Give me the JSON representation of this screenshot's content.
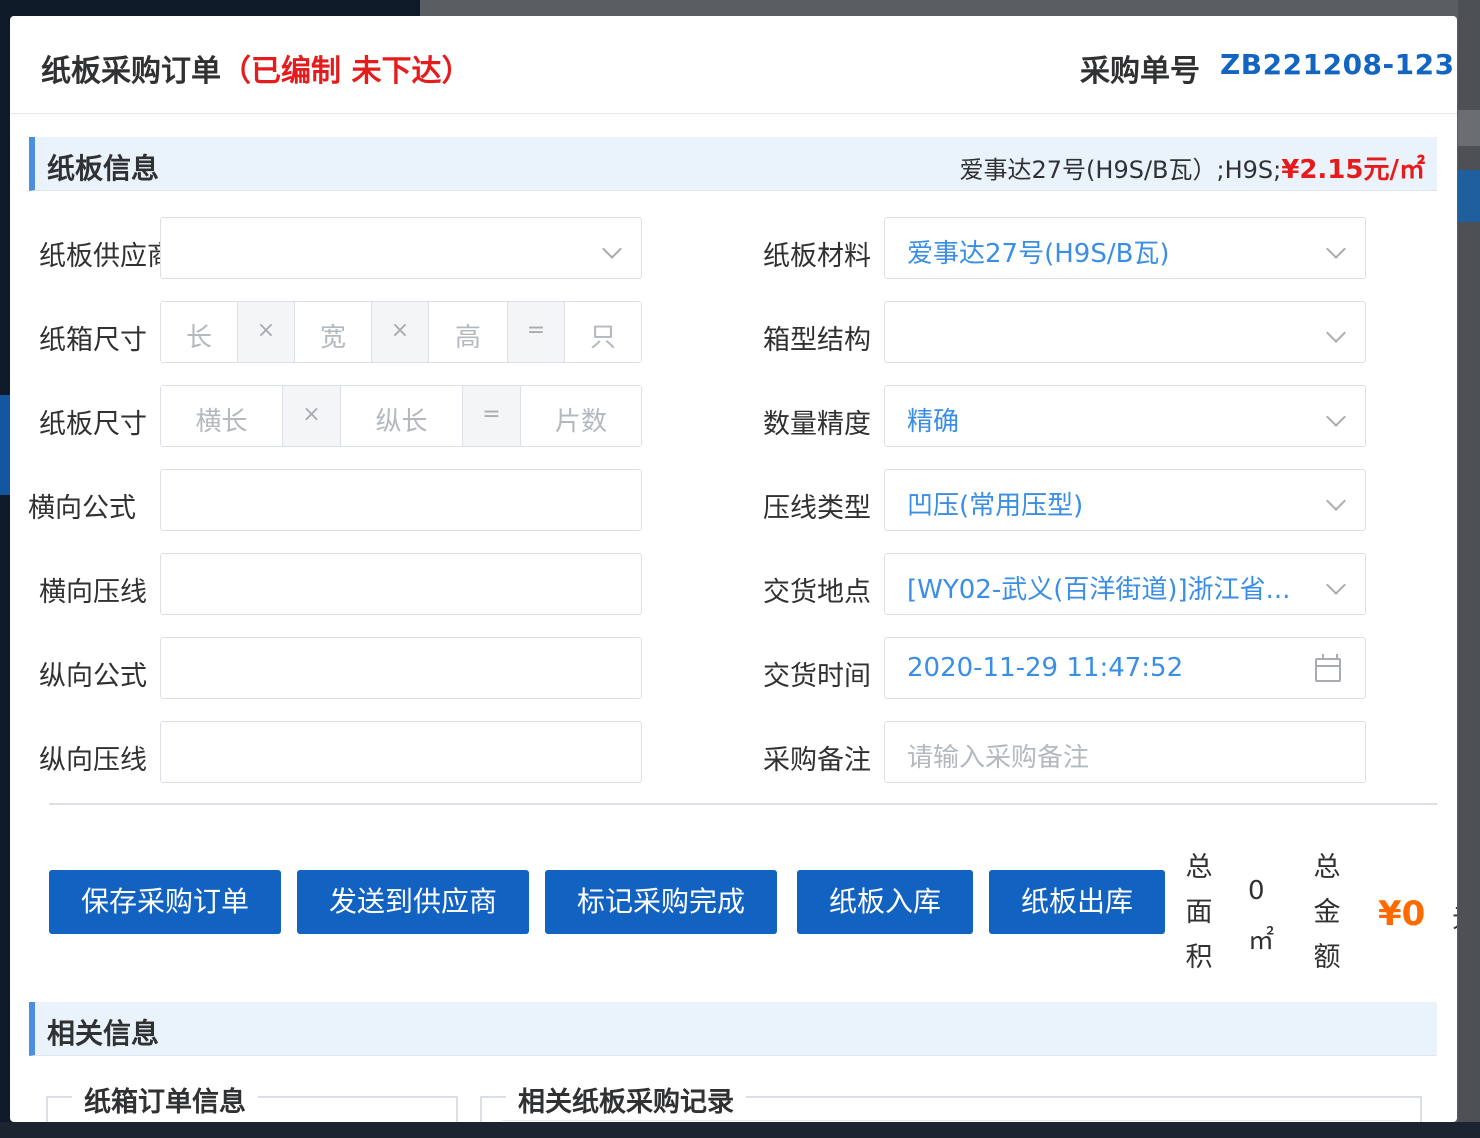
{
  "header": {
    "title": "纸板采购订单",
    "status": "（已编制 未下达）",
    "order_no_label": "采购单号",
    "order_no": "ZB221208-123"
  },
  "section_board": {
    "title": "纸板信息",
    "material_summary": "爱事达27号(H9S/B瓦）;H9S;",
    "price": "¥2.15元/㎡"
  },
  "left_form": {
    "supplier_label": "纸板供应商",
    "box_size_label": "纸箱尺寸",
    "box_size_ph": {
      "length": "长",
      "width": "宽",
      "height": "高",
      "count": "只"
    },
    "board_size_label": "纸板尺寸",
    "board_size_ph": {
      "h_len": "横长",
      "v_len": "纵长",
      "pieces": "片数"
    },
    "op_times": "×",
    "op_eq": "=",
    "h_formula_label": "横向公式",
    "h_crease_label": "横向压线",
    "v_formula_label": "纵向公式",
    "v_crease_label": "纵向压线"
  },
  "right_form": {
    "material_label": "纸板材料",
    "material_value": "爱事达27号(H9S/B瓦)",
    "structure_label": "箱型结构",
    "precision_label": "数量精度",
    "precision_value": "精确",
    "crease_type_label": "压线类型",
    "crease_type_value": "凹压(常用压型)",
    "delivery_place_label": "交货地点",
    "delivery_place_value": "[WY02-武义(百洋街道)]浙江省...",
    "delivery_time_label": "交货时间",
    "delivery_time_value": "2020-11-29 11:47:52",
    "remark_label": "采购备注",
    "remark_ph": "请输入采购备注"
  },
  "actions": {
    "save": "保存采购订单",
    "send": "发送到供应商",
    "mark_done": "标记采购完成",
    "stock_in": "纸板入库",
    "stock_out": "纸板出库"
  },
  "totals": {
    "area_label": [
      "总",
      "面",
      "积"
    ],
    "area_value": "0",
    "area_unit": "㎡",
    "amount_label": [
      "总",
      "金",
      "额"
    ],
    "amount_value": "¥0",
    "amount_unit": "元"
  },
  "section_related": {
    "title": "相关信息",
    "box_order_legend": "纸箱订单信息",
    "board_records_legend": "相关纸板采购记录"
  },
  "colors": {
    "primary": "#1162c1",
    "accent_blue": "#1265c0",
    "status_red": "#e61c1c",
    "amount_orange": "#ff6a00",
    "value_blue": "#3a8ee6"
  }
}
